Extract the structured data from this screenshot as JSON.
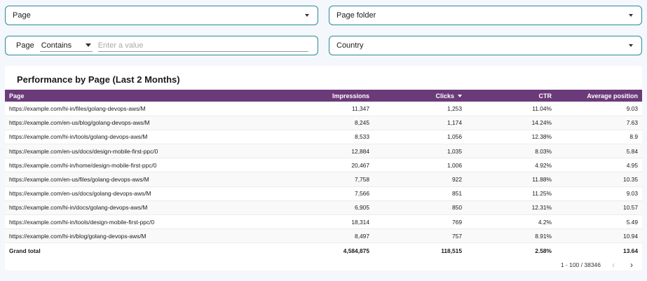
{
  "filters": {
    "page_dropdown": "Page",
    "page_folder_dropdown": "Page folder",
    "page_filter_label": "Page",
    "page_filter_operator": "Contains",
    "page_filter_placeholder": "Enter a value",
    "country_dropdown": "Country"
  },
  "table": {
    "title": "Performance by Page (Last 2 Months)",
    "columns": [
      "Page",
      "Impressions",
      "Clicks",
      "CTR",
      "Average position"
    ],
    "rows": [
      [
        "https://example.com/hi-in/files/golang-devops-aws/M",
        "11,347",
        "1,253",
        "11.04%",
        "9.03"
      ],
      [
        "https://example.com/en-us/blog/golang-devops-aws/M",
        "8,245",
        "1,174",
        "14.24%",
        "7.63"
      ],
      [
        "https://example.com/hi-in/tools/golang-devops-aws/M",
        "8,533",
        "1,056",
        "12.38%",
        "8.9"
      ],
      [
        "https://example.com/en-us/docs/design-mobile-first-ppc/0",
        "12,884",
        "1,035",
        "8.03%",
        "5.84"
      ],
      [
        "https://example.com/hi-in/home/design-mobile-first-ppc/0",
        "20,467",
        "1,006",
        "4.92%",
        "4.95"
      ],
      [
        "https://example.com/en-us/files/golang-devops-aws/M",
        "7,758",
        "922",
        "11.88%",
        "10.35"
      ],
      [
        "https://example.com/en-us/docs/golang-devops-aws/M",
        "7,566",
        "851",
        "11.25%",
        "9.03"
      ],
      [
        "https://example.com/hi-in/docs/golang-devops-aws/M",
        "6,905",
        "850",
        "12.31%",
        "10.57"
      ],
      [
        "https://example.com/hi-in/tools/design-mobile-first-ppc/0",
        "18,314",
        "769",
        "4.2%",
        "5.49"
      ],
      [
        "https://example.com/hi-in/blog/golang-devops-aws/M",
        "8,497",
        "757",
        "8.91%",
        "10.94"
      ]
    ],
    "total": [
      "Grand total",
      "4,584,875",
      "118,515",
      "2.58%",
      "13.64"
    ]
  },
  "pagination": {
    "range": "1 - 100 / 38346",
    "prev_icon": "chevron-left-icon",
    "next_icon": "chevron-right-icon"
  }
}
